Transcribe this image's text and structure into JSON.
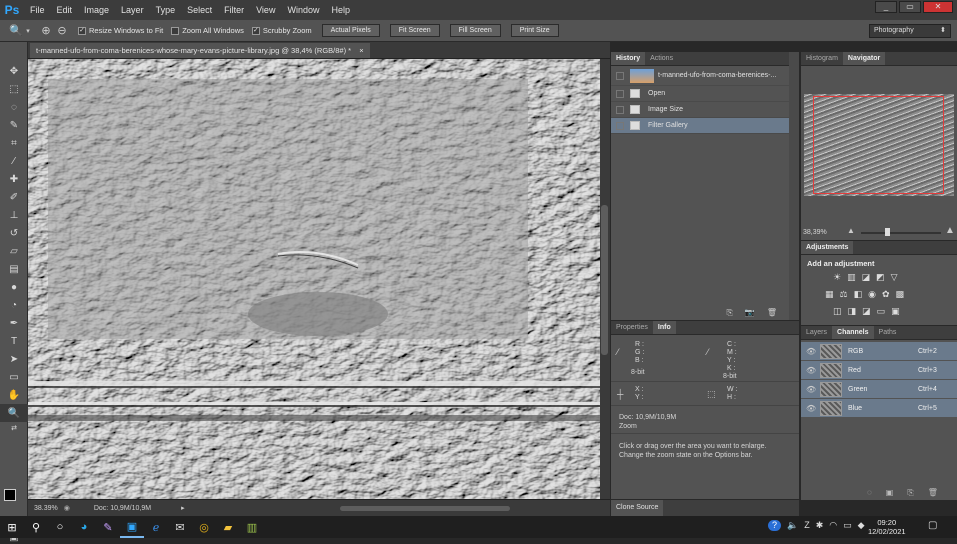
{
  "menubar": {
    "logo": "Ps",
    "items": [
      "File",
      "Edit",
      "Image",
      "Layer",
      "Type",
      "Select",
      "Filter",
      "View",
      "Window",
      "Help"
    ],
    "win_min": "_",
    "win_max": "▭",
    "win_close": "✕"
  },
  "options": {
    "resize_windows": "Resize Windows to Fit",
    "zoom_all": "Zoom All Windows",
    "scrubby": "Scrubby Zoom",
    "actual_pixels": "Actual Pixels",
    "fit_screen": "Fit Screen",
    "fill_screen": "Fill Screen",
    "print_size": "Print Size",
    "workspace": "Photography"
  },
  "document": {
    "tab_title": "t-manned-ufo-from-coma-berenices-whose-mary-evans-picture-library.jpg @ 38,4% (RGB/8#) *",
    "tab_close": "×",
    "zoom": "38.39%",
    "doc_size": "Doc: 10,9M/10,9M"
  },
  "history": {
    "tabs": [
      "History",
      "Actions"
    ],
    "snapshot": "t-manned-ufo-from-coma-berenices-...",
    "steps": [
      "Open",
      "Image Size",
      "Filter Gallery"
    ]
  },
  "info": {
    "tabs": [
      "Properties",
      "Info"
    ],
    "rgb_labels": [
      "R :",
      "G :",
      "B :"
    ],
    "cmyk_labels": [
      "C :",
      "M :",
      "Y :",
      "K :"
    ],
    "bit_left": "8-bit",
    "bit_right": "8-bit",
    "xy": [
      "X :",
      "Y :"
    ],
    "wh": [
      "W :",
      "H :"
    ],
    "doc": "Doc: 10,9M/10,9M",
    "zoom_label": "Zoom",
    "hint1": "Click or drag over the area you want to enlarge.",
    "hint2": "Change the zoom state on the Options bar."
  },
  "clone_source": "Clone Source",
  "navigator": {
    "tabs": [
      "Histogram",
      "Navigator"
    ],
    "zoom": "38,39%"
  },
  "adjustments": {
    "tab": "Adjustments",
    "title": "Add an adjustment"
  },
  "channels": {
    "tabs": [
      "Layers",
      "Channels",
      "Paths"
    ],
    "rows": [
      {
        "name": "RGB",
        "key": "Ctrl+2"
      },
      {
        "name": "Red",
        "key": "Ctrl+3"
      },
      {
        "name": "Green",
        "key": "Ctrl+4"
      },
      {
        "name": "Blue",
        "key": "Ctrl+5"
      }
    ]
  },
  "taskbar": {
    "time": "09:20",
    "date": "12/02/2021"
  }
}
